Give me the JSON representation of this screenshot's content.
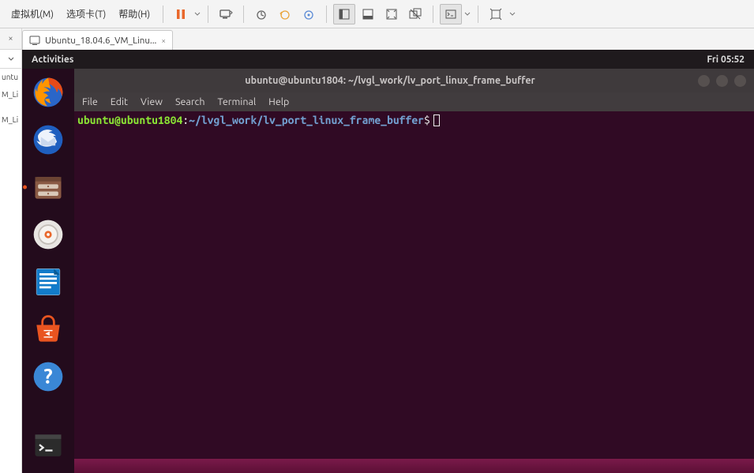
{
  "host": {
    "menu": {
      "vm": "虚拟机(M)",
      "tabs": "选项卡(T)",
      "help": "帮助(H)"
    },
    "tab": {
      "label": "Ubuntu_18.04.6_VM_Linu...",
      "close": "×"
    },
    "library": {
      "entry0": "untu",
      "entry1": "M_Li",
      "entry2": "M_Li"
    },
    "side_close": "×"
  },
  "gnome": {
    "activities": "Activities",
    "clock": "Fri 05:52"
  },
  "dock": {
    "items": [
      {
        "name": "firefox"
      },
      {
        "name": "thunderbird"
      },
      {
        "name": "files",
        "running": true
      },
      {
        "name": "rhythmbox"
      },
      {
        "name": "writer"
      },
      {
        "name": "software"
      },
      {
        "name": "help"
      }
    ]
  },
  "terminal": {
    "title": "ubuntu@ubuntu1804: ~/lvgl_work/lv_port_linux_frame_buffer",
    "menu": {
      "file": "File",
      "edit": "Edit",
      "view": "View",
      "search": "Search",
      "terminal": "Terminal",
      "help": "Help"
    },
    "prompt": {
      "user": "ubuntu@ubuntu1804",
      "colon": ":",
      "path": "~/lvgl_work/lv_port_linux_frame_buffer",
      "dollar": "$"
    }
  }
}
